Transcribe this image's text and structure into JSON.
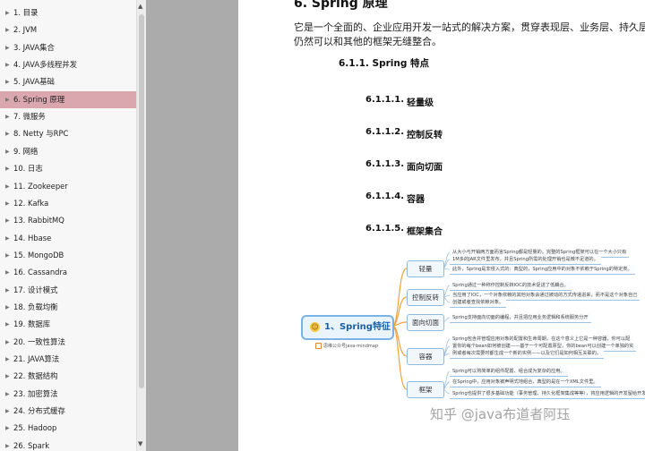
{
  "sidebar": {
    "items": [
      {
        "label": "1. 目录",
        "active": false
      },
      {
        "label": "2. JVM",
        "active": false
      },
      {
        "label": "3. JAVA集合",
        "active": false
      },
      {
        "label": "4. JAVA多线程并发",
        "active": false
      },
      {
        "label": "5. JAVA基础",
        "active": false
      },
      {
        "label": "6. Spring 原理",
        "active": true
      },
      {
        "label": "7.  微服务",
        "active": false
      },
      {
        "label": "8. Netty 与RPC",
        "active": false
      },
      {
        "label": "9. 网络",
        "active": false
      },
      {
        "label": "10. 日志",
        "active": false
      },
      {
        "label": "11. Zookeeper",
        "active": false
      },
      {
        "label": "12. Kafka",
        "active": false
      },
      {
        "label": "13. RabbitMQ",
        "active": false
      },
      {
        "label": "14. Hbase",
        "active": false
      },
      {
        "label": "15. MongoDB",
        "active": false
      },
      {
        "label": "16. Cassandra",
        "active": false
      },
      {
        "label": "17. 设计模式",
        "active": false
      },
      {
        "label": "18. 负载均衡",
        "active": false
      },
      {
        "label": "19. 数据库",
        "active": false
      },
      {
        "label": "20. 一致性算法",
        "active": false
      },
      {
        "label": "21. JAVA算法",
        "active": false
      },
      {
        "label": "22. 数据结构",
        "active": false
      },
      {
        "label": "23. 加密算法",
        "active": false
      },
      {
        "label": "24. 分布式缓存",
        "active": false
      },
      {
        "label": "25. Hadoop",
        "active": false
      },
      {
        "label": "26. Spark",
        "active": false
      }
    ],
    "active_color": "#d9a7ad"
  },
  "document": {
    "title": "6. Spring 原理",
    "paragraph_line1": "它是一个全面的、企业应用开发一站式的解决方案，贯穿表现层、业务层、持久层。但是 Spring",
    "paragraph_line2": "仍然可以和其他的框架无缝整合。",
    "section": "6.1.1.  Spring 特点",
    "subsections": [
      {
        "num": "6.1.1.1.",
        "title": "轻量级"
      },
      {
        "num": "6.1.1.2.",
        "title": "控制反转"
      },
      {
        "num": "6.1.1.3.",
        "title": "面向切面"
      },
      {
        "num": "6.1.1.4.",
        "title": "容器"
      },
      {
        "num": "6.1.1.5.",
        "title": "框架集合"
      }
    ]
  },
  "mindmap": {
    "center": "1、Spring特征",
    "credit": "思维公众号java-mindmap",
    "branches": [
      {
        "label": "轻量",
        "leaves": [
          "从大小与开销两方面而言Spring都是轻量的。完整的Spring框架可以在一个大小只有",
          "1M多的JAR文件里发布，并且Spring所需的处理开销也是微不足道的。",
          "此外，Spring是非侵入式的：典型的，Spring应用中的对象不依赖于Spring的特定类。"
        ]
      },
      {
        "label": "控制反转",
        "leaves": [
          "Spring通过一种称作控制反转IOC的技术促进了低耦合。",
          "当应用了IOC，一个对象依赖的其他对象会通过被动的方式传递进来，而不是这个对象自己",
          "创建或者查找依赖对象。"
        ]
      },
      {
        "label": "面向切面",
        "leaves": [
          "Spring支持面向切面的编程，并且把应用业务逻辑和系统服务分开"
        ]
      },
      {
        "label": "容器",
        "leaves": [
          "Spring包含并管理应用对象的配置和生命周期，在这个意义上它是一种容器，你可以配",
          "置你的每个bean如何被创建——基于一个可配置原型，你的bean可以创建一个单独的实",
          "例或者每次需要时都生成一个新的实例——以及它们是如何相互关联的。"
        ]
      },
      {
        "label": "框架",
        "leaves": [
          "Spring可以将简单的组件配置、组合成为复杂的应用。",
          "在Spring中，应用对象被声明式地组合，典型的是在一个XML文件里。",
          "Spring也提供了很多基础功能（事务管理、持久化框架集成等等），将应用逻辑的开发留给开发者。"
        ]
      }
    ]
  },
  "watermark": "知乎 @java布道者阿珏",
  "colors": {
    "node_border": "#8fb9dd",
    "center_border": "#7ab3e5",
    "center_text": "#1b5fa6",
    "line": "#f0a23b"
  }
}
